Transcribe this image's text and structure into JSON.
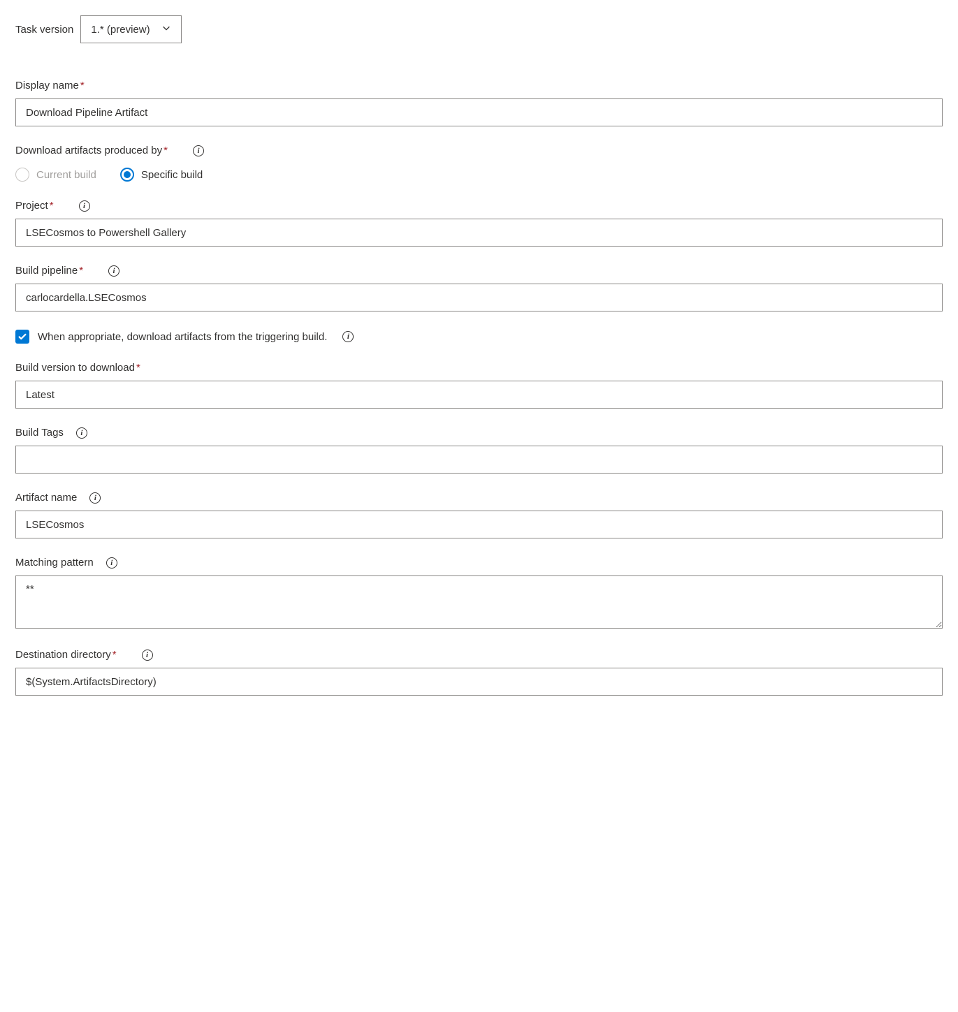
{
  "taskVersion": {
    "label": "Task version",
    "value": "1.* (preview)"
  },
  "displayName": {
    "label": "Display name",
    "value": "Download Pipeline Artifact"
  },
  "downloadProducedBy": {
    "label": "Download artifacts produced by",
    "options": {
      "current": "Current build",
      "specific": "Specific build"
    }
  },
  "project": {
    "label": "Project",
    "value": "LSECosmos to Powershell Gallery"
  },
  "buildPipeline": {
    "label": "Build pipeline",
    "value": "carlocardella.LSECosmos"
  },
  "triggeringBuildCheckbox": {
    "label": "When appropriate, download artifacts from the triggering build."
  },
  "buildVersion": {
    "label": "Build version to download",
    "value": "Latest"
  },
  "buildTags": {
    "label": "Build Tags",
    "value": ""
  },
  "artifactName": {
    "label": "Artifact name",
    "value": "LSECosmos"
  },
  "matchingPattern": {
    "label": "Matching pattern",
    "value": "**"
  },
  "destinationDirectory": {
    "label": "Destination directory",
    "value": "$(System.ArtifactsDirectory)"
  }
}
